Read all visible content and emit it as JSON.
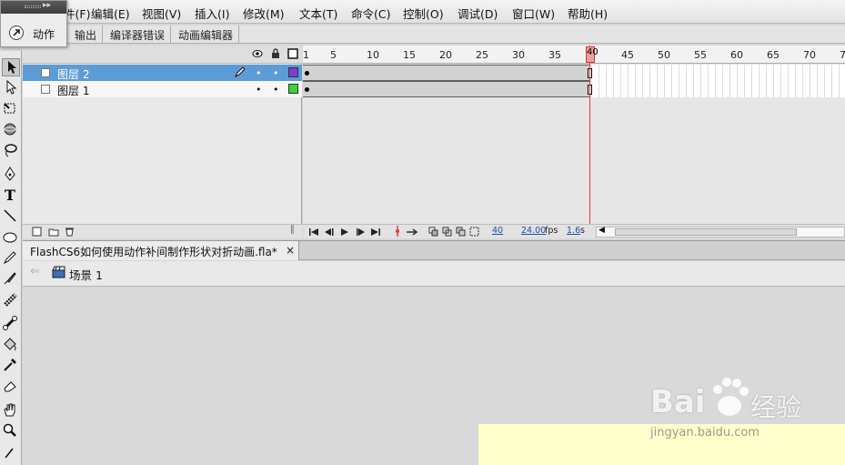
{
  "menu": [
    "件(F)",
    "编辑(E)",
    "视图(V)",
    "插入(I)",
    "修改(M)",
    "文本(T)",
    "命令(C)",
    "控制(O)",
    "调试(D)",
    "窗口(W)",
    "帮助(H)"
  ],
  "actions_panel": {
    "label": "动作",
    "collapse_glyph": "▸▸"
  },
  "panel_tabs": [
    "输出",
    "编译器错误",
    "动画编辑器"
  ],
  "timeline": {
    "layers": [
      {
        "name": "图层 2",
        "color": "#7b3fd6",
        "selected": true
      },
      {
        "name": "图层 1",
        "color": "#3ad33a",
        "selected": false
      }
    ],
    "ruler_ticks": [
      "1",
      "5",
      "10",
      "15",
      "20",
      "25",
      "30",
      "35",
      "40",
      "45",
      "50",
      "55",
      "60",
      "65",
      "70",
      "7"
    ],
    "current_frame": "40",
    "fps": "24.00",
    "fps_unit": "fps",
    "elapsed": "1.6",
    "elapsed_unit": "s",
    "playhead_label": "40"
  },
  "document": {
    "tab_title": "FlashCS6如何使用动作补间制作形状对折动画.fla*",
    "close_glyph": "×",
    "scene": "场景 1",
    "back_glyph": "⇐"
  },
  "watermark": {
    "brand": "Bai",
    "brand2": "经验",
    "url": "jingyan.baidu.com"
  },
  "icons": [
    "pointer-icon",
    "subselect-icon",
    "free-transform-icon",
    "3d-rotation-icon",
    "lasso-icon",
    "pen-icon",
    "text-icon",
    "line-icon",
    "oval-icon",
    "pencil-icon",
    "brush-icon",
    "deco-icon",
    "bone-icon",
    "paint-bucket-icon",
    "eyedropper-icon",
    "eraser-icon",
    "hand-icon",
    "zoom-icon"
  ]
}
